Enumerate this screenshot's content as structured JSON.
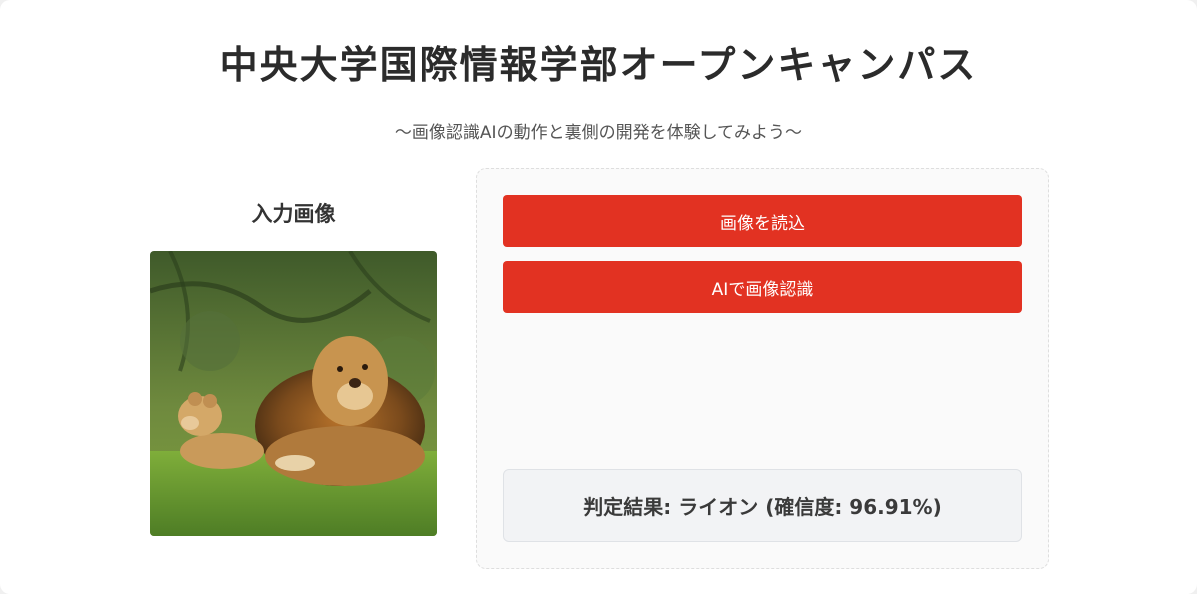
{
  "header": {
    "title": "中央大学国際情報学部オープンキャンパス",
    "subtitle": "〜画像認識AIの動作と裏側の開発を体験してみよう〜"
  },
  "input_section": {
    "heading": "入力画像",
    "image_subject": "lion-and-cub-photo"
  },
  "controls": {
    "load_button_label": "画像を読込",
    "recognize_button_label": "AIで画像認識"
  },
  "result": {
    "text": "判定結果: ライオン (確信度: 96.91%)"
  },
  "colors": {
    "accent": "#e23222",
    "background": "#ffffff",
    "result_background": "#f2f3f5"
  }
}
